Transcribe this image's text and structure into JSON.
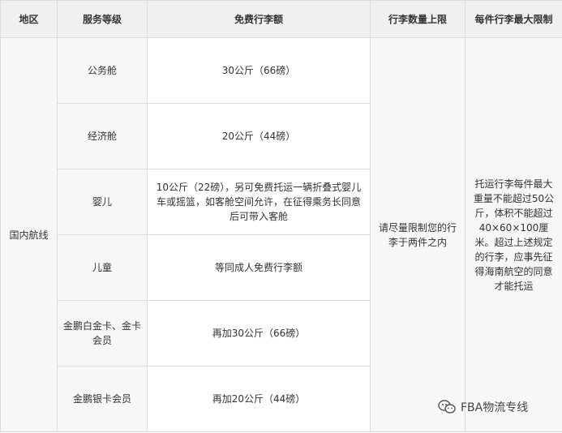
{
  "headers": {
    "region": "地区",
    "service": "服务等级",
    "allowance": "免费行李额",
    "count_limit": "行李数量上限",
    "max_limit": "每件行李最大限制"
  },
  "region": "国内航线",
  "rows": [
    {
      "service": "公务舱",
      "allowance": "30公斤（66磅）"
    },
    {
      "service": "经济舱",
      "allowance": "20公斤（44磅）"
    },
    {
      "service": "婴儿",
      "allowance": "10公斤（22磅），另可免费托运一辆折叠式婴儿车或摇篮，如客舱空间允许，在征得乘务长同意后可带入客舱"
    },
    {
      "service": "儿童",
      "allowance": "等同成人免费行李额"
    },
    {
      "service": "金鹏白金卡、金卡会员",
      "allowance": "再加30公斤（66磅）"
    },
    {
      "service": "金鹏银卡会员",
      "allowance": "再加20公斤（44磅）"
    }
  ],
  "count_limit": "请尽量限制您的行李于两件之内",
  "max_limit": "托运行李每件最大重量不能超过50公斤，体积不能超过40×60×100厘米。超过上述规定的行李，应事先征得海南航空的同意才能托运",
  "watermark": "FBA物流专线"
}
